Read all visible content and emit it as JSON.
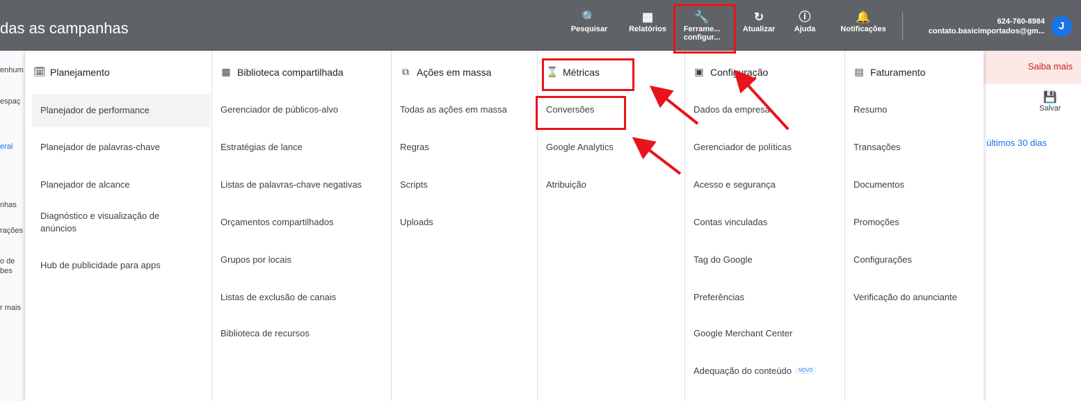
{
  "header": {
    "title": "das as campanhas",
    "tools": [
      {
        "icon": "search-icon",
        "label": "Pesquisar"
      },
      {
        "icon": "reports-icon",
        "label": "Relatórios"
      },
      {
        "icon": "wrench-icon",
        "label": "Ferrame... configur..."
      },
      {
        "icon": "refresh-icon",
        "label": "Atualizar"
      },
      {
        "icon": "help-icon",
        "label": "Ajuda"
      },
      {
        "icon": "bell-icon",
        "label": "Notificações"
      }
    ],
    "account_id": "624-760-8984",
    "account_email": "contato.basicimportados@gm...",
    "avatar_letter": "J"
  },
  "background": {
    "left_fragments": [
      "enhum",
      "espaç",
      "eral",
      "nhas",
      "rações",
      "o de",
      "bes",
      "r mais"
    ],
    "alert_link": "Saiba mais",
    "save_label": "Salvar",
    "date_range": "últimos 30 dias"
  },
  "menu": {
    "columns": [
      {
        "heading": "Planejamento",
        "icon": "calendar-icon",
        "items": [
          "Planejador de performance",
          "Planejador de palavras-chave",
          "Planejador de alcance",
          "Diagnóstico e visualização de anúncios",
          "Hub de publicidade para apps"
        ]
      },
      {
        "heading": "Biblioteca compartilhada",
        "icon": "library-icon",
        "items": [
          "Gerenciador de públicos-alvo",
          "Estratégias de lance",
          "Listas de palavras-chave negativas",
          "Orçamentos compartilhados",
          "Grupos por locais",
          "Listas de exclusão de canais",
          "Biblioteca de recursos"
        ]
      },
      {
        "heading": "Ações em massa",
        "icon": "bulk-actions-icon",
        "items": [
          "Todas as ações em massa",
          "Regras",
          "Scripts",
          "Uploads"
        ]
      },
      {
        "heading": "Métricas",
        "icon": "hourglass-icon",
        "items": [
          "Conversões",
          "Google Analytics",
          "Atribuição"
        ]
      },
      {
        "heading": "Configuração",
        "icon": "settings-box-icon",
        "items": [
          "Dados da empresa",
          "Gerenciador de políticas",
          "Acesso e segurança",
          "Contas vinculadas",
          "Tag do Google",
          "Preferências",
          "Google Merchant Center",
          "Adequação do conteúdo"
        ],
        "badge": "NOVO"
      },
      {
        "heading": "Faturamento",
        "icon": "card-icon",
        "items": [
          "Resumo",
          "Transações",
          "Documentos",
          "Promoções",
          "Configurações",
          "Verificação do anunciante"
        ]
      }
    ]
  },
  "colors": {
    "topbar": "#5f6368",
    "annotation": "#e8141b",
    "accent": "#1a73e8"
  }
}
